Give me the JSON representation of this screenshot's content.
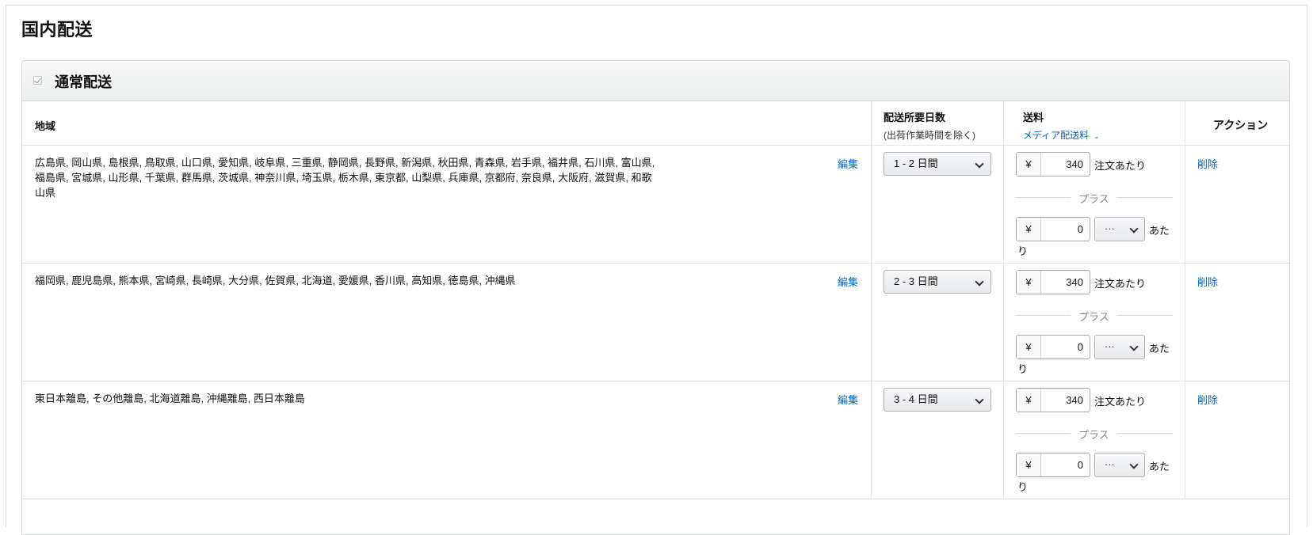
{
  "page": {
    "title": "国内配送"
  },
  "panel": {
    "title": "通常配送",
    "checked": true
  },
  "columns": {
    "region": "地域",
    "days": "配送所要日数",
    "days_sub": "(出荷作業時間を除く)",
    "fee": "送料",
    "fee_sub": "メディア配送料",
    "action": "アクション"
  },
  "rows": [
    {
      "regions": "広島県, 岡山県, 島根県, 鳥取県, 山口県, 愛知県, 岐阜県, 三重県, 静岡県, 長野県, 新潟県, 秋田県, 青森県, 岩手県, 福井県, 石川県, 富山県, 福島県, 宮城県, 山形県, 千葉県, 群馬県, 茨城県, 神奈川県, 埼玉県, 栃木県, 東京都, 山梨県, 兵庫県, 京都府, 奈良県, 大阪府, 滋賀県, 和歌山県",
      "edit": "編集",
      "days": "1 - 2 日間",
      "currency": "¥",
      "fee": "340",
      "per_order": "注文あたり",
      "plus": "プラス",
      "extra_fee": "0",
      "unit": "···",
      "per_unit_a": "あた",
      "per_unit_b": "り",
      "delete": "削除"
    },
    {
      "regions": "福岡県, 鹿児島県, 熊本県, 宮崎県, 長崎県, 大分県, 佐賀県, 北海道, 愛媛県, 香川県, 高知県, 徳島県, 沖縄県",
      "edit": "編集",
      "days": "2 - 3 日間",
      "currency": "¥",
      "fee": "340",
      "per_order": "注文あたり",
      "plus": "プラス",
      "extra_fee": "0",
      "unit": "···",
      "per_unit_a": "あた",
      "per_unit_b": "り",
      "delete": "削除"
    },
    {
      "regions": "東日本離島, その他離島, 北海道離島, 沖縄離島, 西日本離島",
      "edit": "編集",
      "days": "3 - 4 日間",
      "currency": "¥",
      "fee": "340",
      "per_order": "注文あたり",
      "plus": "プラス",
      "extra_fee": "0",
      "unit": "···",
      "per_unit_a": "あた",
      "per_unit_b": "り",
      "delete": "削除"
    }
  ],
  "colors": {
    "link": "#0066c0",
    "border": "#d5d9d9"
  }
}
